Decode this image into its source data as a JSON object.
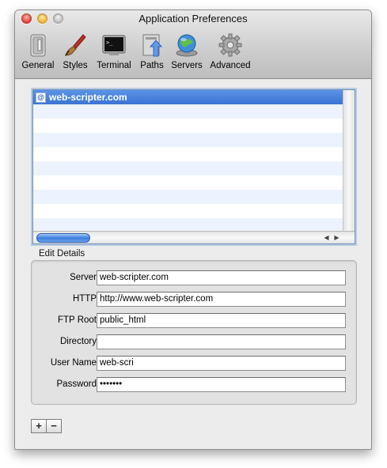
{
  "window": {
    "title": "Application Preferences"
  },
  "toolbar": {
    "items": [
      {
        "label": "General",
        "icon": "general-switch-icon"
      },
      {
        "label": "Styles",
        "icon": "paintbrush-icon"
      },
      {
        "label": "Terminal",
        "icon": "terminal-icon"
      },
      {
        "label": "Paths",
        "icon": "paths-upload-icon"
      },
      {
        "label": "Servers",
        "icon": "servers-globe-icon"
      },
      {
        "label": "Advanced",
        "icon": "gear-icon"
      }
    ],
    "selected": "Servers"
  },
  "server_list": {
    "items": [
      {
        "label": "web-scripter.com",
        "icon": "at-sign-icon",
        "selected": true
      }
    ],
    "selection_color": "#3b74d4",
    "scroll_fraction_horizontal": 0.18
  },
  "edit_details": {
    "title": "Edit Details",
    "fields": {
      "server": {
        "label": "Server",
        "value": "web-scripter.com"
      },
      "http": {
        "label": "HTTP",
        "value": "http://www.web-scripter.com"
      },
      "ftp_root": {
        "label": "FTP Root",
        "value": "public_html"
      },
      "directory": {
        "label": "Directory",
        "value": ""
      },
      "user_name": {
        "label": "User Name",
        "value": "web-scri"
      },
      "password": {
        "label": "Password",
        "value": "•••••••"
      }
    }
  },
  "buttons": {
    "add": "+",
    "remove": "−"
  },
  "scroll_arrows": {
    "left": "◀",
    "right": "▶"
  }
}
